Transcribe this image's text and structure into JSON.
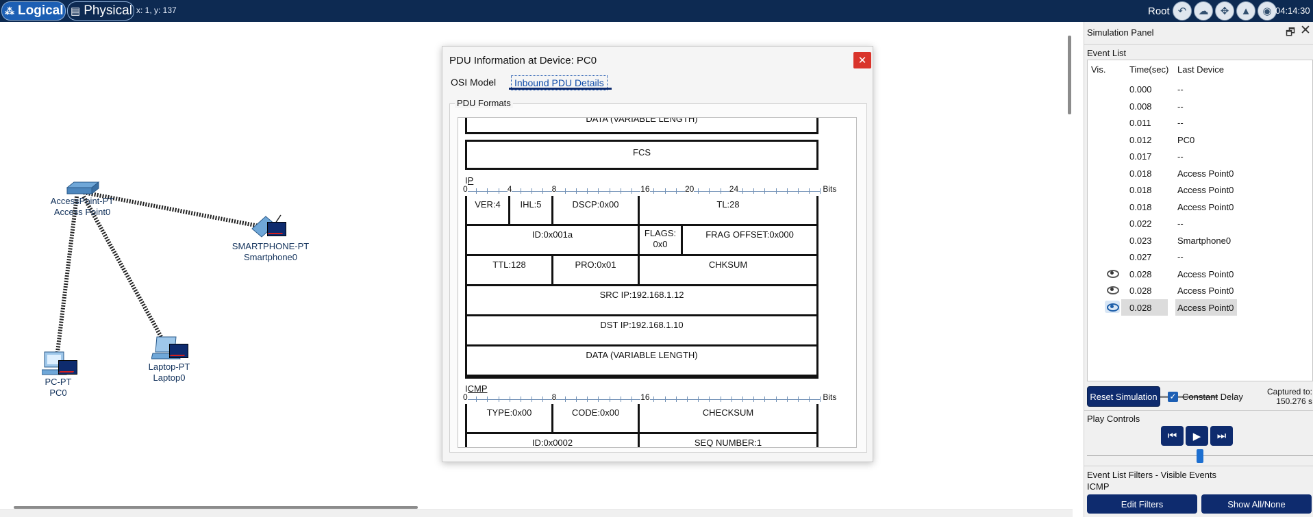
{
  "topbar": {
    "logical_label": "Logical",
    "physical_label": "Physical",
    "coord": "x: 1, y: 137",
    "root_label": "Root",
    "clock": "04:14:30",
    "icons": [
      "back-icon",
      "cloud-icon",
      "move-icon",
      "background-image-icon",
      "viewport-icon"
    ]
  },
  "topology": {
    "devices": [
      {
        "type": "AccessPoint-PT",
        "name": "Access Point0",
        "icon": "access-point-icon"
      },
      {
        "type": "SMARTPHONE-PT",
        "name": "Smartphone0",
        "icon": "smartphone-icon"
      },
      {
        "type": "PC-PT",
        "name": "PC0",
        "icon": "pc-icon"
      },
      {
        "type": "Laptop-PT",
        "name": "Laptop0",
        "icon": "laptop-icon"
      }
    ]
  },
  "pdu_dialog": {
    "title": "PDU Information at Device: PC0",
    "close": "✕",
    "tabs": [
      "OSI Model",
      "Inbound PDU Details"
    ],
    "active_tab": "Inbound PDU Details",
    "group_label": "PDU Formats",
    "frame": {
      "data": "DATA (VARIABLE LENGTH)",
      "fcs": "FCS"
    },
    "ip": {
      "label": "IP",
      "ruler": [
        "0",
        "4",
        "8",
        "16",
        "20",
        "24",
        "Bits"
      ],
      "ver": "VER:4",
      "ihl": "IHL:5",
      "dscp": "DSCP:0x00",
      "tl": "TL:28",
      "id": "ID:0x001a",
      "flags": "FLAGS:",
      "flags_val": "0x0",
      "frag": "FRAG OFFSET:0x000",
      "ttl": "TTL:128",
      "pro": "PRO:0x01",
      "chksum": "CHKSUM",
      "src": "SRC IP:192.168.1.12",
      "dst": "DST IP:192.168.1.10",
      "data": "DATA (VARIABLE LENGTH)"
    },
    "icmp": {
      "label": "ICMP",
      "ruler": [
        "0",
        "8",
        "16",
        "Bits"
      ],
      "type": "TYPE:0x00",
      "code": "CODE:0x00",
      "checksum": "CHECKSUM",
      "id": "ID:0x0002",
      "seq": "SEQ NUMBER:1"
    }
  },
  "sim_panel": {
    "title": "Simulation Panel",
    "restore": "🗗",
    "close": "✕",
    "event_list_label": "Event List",
    "columns": [
      "Vis.",
      "Time(sec)",
      "Last Device"
    ],
    "events": [
      {
        "vis": false,
        "time": "0.000",
        "device": "--"
      },
      {
        "vis": false,
        "time": "0.008",
        "device": "--"
      },
      {
        "vis": false,
        "time": "0.011",
        "device": "--"
      },
      {
        "vis": false,
        "time": "0.012",
        "device": "PC0"
      },
      {
        "vis": false,
        "time": "0.017",
        "device": "--"
      },
      {
        "vis": false,
        "time": "0.018",
        "device": "Access Point0"
      },
      {
        "vis": false,
        "time": "0.018",
        "device": "Access Point0"
      },
      {
        "vis": false,
        "time": "0.018",
        "device": "Access Point0"
      },
      {
        "vis": false,
        "time": "0.022",
        "device": "--"
      },
      {
        "vis": false,
        "time": "0.023",
        "device": "Smartphone0"
      },
      {
        "vis": false,
        "time": "0.027",
        "device": "--"
      },
      {
        "vis": true,
        "time": "0.028",
        "device": "Access Point0"
      },
      {
        "vis": true,
        "time": "0.028",
        "device": "Access Point0"
      },
      {
        "vis": true,
        "time": "0.028",
        "device": "Access Point0",
        "selected": true
      }
    ],
    "reset_label": "Reset Simulation",
    "constant_delay_label": "Constant Delay",
    "constant_delay_checked": true,
    "captured_label": "Captured to:",
    "captured_value": "150.276 s",
    "play_controls_label": "Play Controls",
    "play_buttons": [
      "⏮",
      "▶",
      "⏭"
    ],
    "filters_label": "Event List Filters - Visible Events",
    "filters_value": "ICMP",
    "edit_filters_label": "Edit Filters",
    "show_all_label": "Show All/None"
  },
  "colors": {
    "topbar": "#0d2a52",
    "button": "#0e2b6e",
    "accent": "#1d5fb4",
    "close": "#d9342b"
  }
}
